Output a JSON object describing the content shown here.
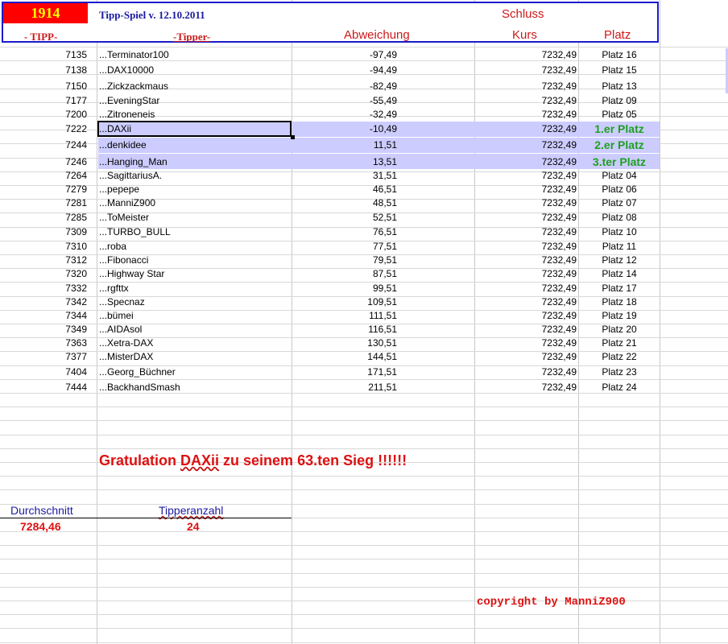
{
  "header": {
    "number": "1914",
    "title": "Tipp-Spiel v. 12.10.2011",
    "schluss": "Schluss",
    "columns": [
      "- TIPP-",
      "-Tipper-",
      "Abweichung",
      "Kurs",
      "Platz"
    ]
  },
  "rows": [
    {
      "tipp": "7135",
      "tipper": "...Terminator100",
      "abw": "-97,49",
      "kurs": "7232,49",
      "platz": "Platz 16"
    },
    {
      "tipp": "7138",
      "tipper": "...DAX10000",
      "abw": "-94,49",
      "kurs": "7232,49",
      "platz": "Platz 15"
    },
    {
      "tipp": "7150",
      "tipper": "...Zickzackmaus",
      "abw": "-82,49",
      "kurs": "7232,49",
      "platz": "Platz 13"
    },
    {
      "tipp": "7177",
      "tipper": "...EveningStar",
      "abw": "-55,49",
      "kurs": "7232,49",
      "platz": "Platz 09"
    },
    {
      "tipp": "7200",
      "tipper": "...Zitroneneis",
      "abw": "-32,49",
      "kurs": "7232,49",
      "platz": "Platz 05"
    },
    {
      "tipp": "7222",
      "tipper": "...DAXii",
      "abw": "-10,49",
      "kurs": "7232,49",
      "platz": "1.er Platz",
      "winner": true
    },
    {
      "tipp": "7244",
      "tipper": "...denkidee",
      "abw": "11,51",
      "kurs": "7232,49",
      "platz": "2.er Platz",
      "winner": true
    },
    {
      "tipp": "7246",
      "tipper": "...Hanging_Man",
      "abw": "13,51",
      "kurs": "7232,49",
      "platz": "3.ter Platz",
      "winner": true
    },
    {
      "tipp": "7264",
      "tipper": "...SagittariusA.",
      "abw": "31,51",
      "kurs": "7232,49",
      "platz": "Platz 04"
    },
    {
      "tipp": "7279",
      "tipper": "...pepepe",
      "abw": "46,51",
      "kurs": "7232,49",
      "platz": "Platz 06"
    },
    {
      "tipp": "7281",
      "tipper": "...ManniZ900",
      "abw": "48,51",
      "kurs": "7232,49",
      "platz": "Platz 07"
    },
    {
      "tipp": "7285",
      "tipper": "...ToMeister",
      "abw": "52,51",
      "kurs": "7232,49",
      "platz": "Platz 08"
    },
    {
      "tipp": "7309",
      "tipper": "...TURBO_BULL",
      "abw": "76,51",
      "kurs": "7232,49",
      "platz": "Platz 10"
    },
    {
      "tipp": "7310",
      "tipper": "...roba",
      "abw": "77,51",
      "kurs": "7232,49",
      "platz": "Platz 11"
    },
    {
      "tipp": "7312",
      "tipper": "...Fibonacci",
      "abw": "79,51",
      "kurs": "7232,49",
      "platz": "Platz 12"
    },
    {
      "tipp": "7320",
      "tipper": "...Highway Star",
      "abw": "87,51",
      "kurs": "7232,49",
      "platz": "Platz 14"
    },
    {
      "tipp": "7332",
      "tipper": "...rgfttx",
      "abw": "99,51",
      "kurs": "7232,49",
      "platz": "Platz 17"
    },
    {
      "tipp": "7342",
      "tipper": "...Specnaz",
      "abw": "109,51",
      "kurs": "7232,49",
      "platz": "Platz 18"
    },
    {
      "tipp": "7344",
      "tipper": "...bümei",
      "abw": "111,51",
      "kurs": "7232,49",
      "platz": "Platz 19"
    },
    {
      "tipp": "7349",
      "tipper": "...AIDAsol",
      "abw": "116,51",
      "kurs": "7232,49",
      "platz": "Platz 20"
    },
    {
      "tipp": "7363",
      "tipper": "...Xetra-DAX",
      "abw": "130,51",
      "kurs": "7232,49",
      "platz": "Platz 21"
    },
    {
      "tipp": "7377",
      "tipper": "...MisterDAX",
      "abw": "144,51",
      "kurs": "7232,49",
      "platz": "Platz 22"
    },
    {
      "tipp": "7404",
      "tipper": "...Georg_Büchner",
      "abw": "171,51",
      "kurs": "7232,49",
      "platz": "Platz 23"
    },
    {
      "tipp": "7444",
      "tipper": "...BackhandSmash",
      "abw": "211,51",
      "kurs": "7232,49",
      "platz": "Platz 24"
    }
  ],
  "message": {
    "part1": "Gratulation ",
    "winner": "DAXii",
    "part2": " zu seinem 63.ten Sieg !!!!!!"
  },
  "stats": {
    "average_label": "Durchschnitt",
    "average_value": "7284,46",
    "count_label": "Tipperanzahl",
    "count_value": "24"
  },
  "footer": {
    "copyright": "copyright by ManniZ900"
  },
  "colors": {
    "header_border": "#1a1acc",
    "title_bg": "#ff0000",
    "title_text": "#ffff00",
    "highlight": "#ccccff",
    "winner_text": "#1ea01e",
    "accent_red": "#dd1111"
  }
}
